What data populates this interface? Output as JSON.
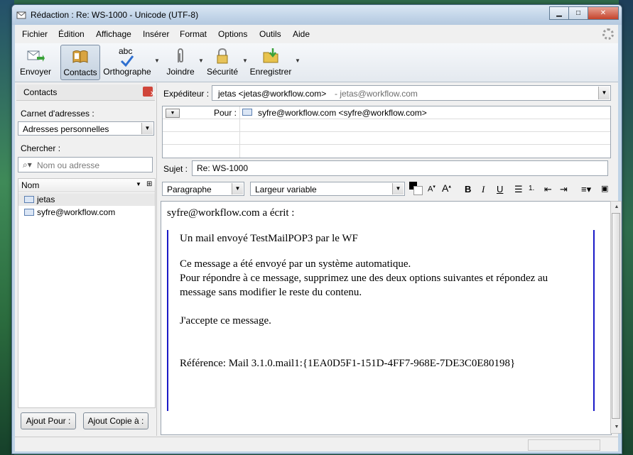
{
  "window": {
    "title": "Rédaction : Re: WS-1000 - Unicode (UTF-8)"
  },
  "menu": {
    "items": [
      {
        "label": "Fichier"
      },
      {
        "label": "Édition"
      },
      {
        "label": "Affichage"
      },
      {
        "label": "Insérer"
      },
      {
        "label": "Format"
      },
      {
        "label": "Options"
      },
      {
        "label": "Outils"
      },
      {
        "label": "Aide"
      }
    ]
  },
  "toolbar": {
    "send": "Envoyer",
    "contacts": "Contacts",
    "spell": "Orthographe",
    "attach": "Joindre",
    "security": "Sécurité",
    "save": "Enregistrer",
    "spell_icon_text": "abc"
  },
  "sidebar": {
    "title": "Contacts",
    "addressbook_label": "Carnet d'adresses :",
    "addressbook_value": "Adresses personnelles",
    "search_label": "Chercher :",
    "search_placeholder": "Nom ou adresse",
    "column_name": "Nom",
    "contacts": [
      {
        "name": "jetas"
      },
      {
        "name": "syfre@workflow.com"
      }
    ],
    "btn_to": "Ajout Pour :",
    "btn_cc": "Ajout Copie à :"
  },
  "compose": {
    "from_label": "Expéditeur :",
    "from_value": "jetas <jetas@workflow.com>",
    "from_hint": "- jetas@workflow.com",
    "to_label": "Pour :",
    "to_value": "syfre@workflow.com <syfre@workflow.com>",
    "subject_label": "Sujet :",
    "subject_value": "Re: WS-1000"
  },
  "format": {
    "paragraph": "Paragraphe",
    "font": "Largeur variable",
    "bold": "B",
    "italic": "I",
    "underline": "U"
  },
  "body": {
    "intro": "syfre@workflow.com a écrit :",
    "quote_line1": "Un mail envoyé TestMailPOP3 par le WF",
    "quote_line2": "Ce message a été envoyé par un système automatique.",
    "quote_line3": "Pour répondre à ce message, supprimez une des deux options suivantes et répondez au",
    "quote_line4": "message sans modifier le reste du contenu.",
    "quote_line5": "J'accepte ce message.",
    "quote_line6": "Référence: Mail 3.1.0.mail1:{1EA0D5F1-151D-4FF7-968E-7DE3C0E80198}"
  },
  "colors": {
    "quote_bar": "#1a1ac8",
    "close_button": "#c4432b"
  }
}
